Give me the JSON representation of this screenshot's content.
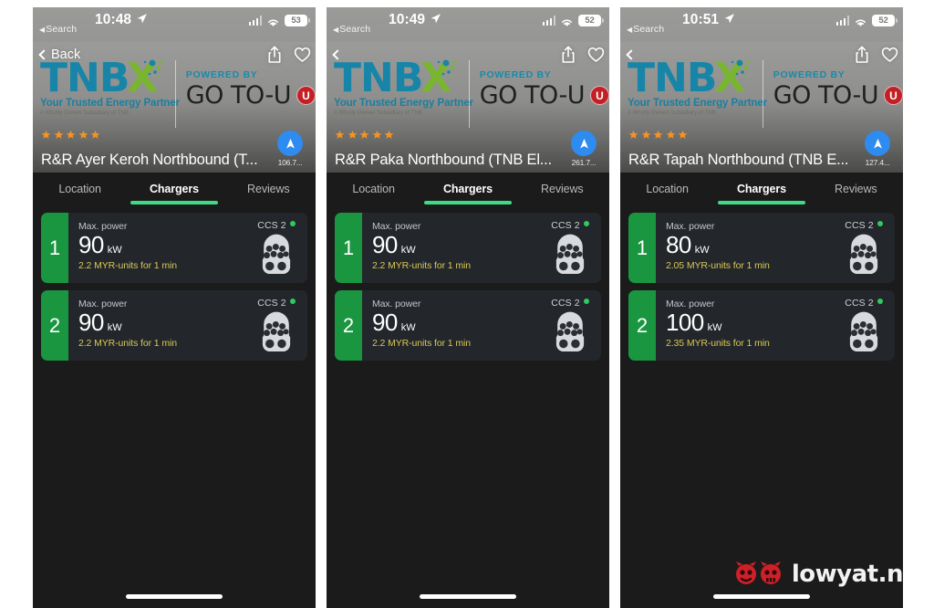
{
  "brand": {
    "logo_main": "TNB",
    "logo_accent": "X",
    "tagline": "Your Trusted Energy Partner",
    "subline": "A Wholly Owned Subsidiary of TNB",
    "powered_by": "POWERED BY",
    "partner_name": "GO TO-U",
    "partner_badge": "U",
    "colors": {
      "tnb_blue": "#1785a8",
      "x_green": "#79b530",
      "partner_red": "#c32026",
      "accent_green": "#3ddc84",
      "card_green": "#1a9641",
      "price_yellow": "#d9c756",
      "nav_blue": "#2e8bef",
      "star_orange": "#f59323"
    }
  },
  "icons": {
    "back": "chevron-left-icon",
    "share": "share-icon",
    "favorite": "heart-icon",
    "navigate": "navigate-arrow-icon",
    "connector": "ccs2-connector-icon",
    "signal": "cellular-signal-icon",
    "wifi": "wifi-icon",
    "battery": "battery-icon",
    "location": "location-arrow-icon",
    "star": "star-icon"
  },
  "tabs": [
    {
      "label": "Location",
      "active": false
    },
    {
      "label": "Chargers",
      "active": true
    },
    {
      "label": "Reviews",
      "active": false
    }
  ],
  "labels": {
    "max_power": "Max. power",
    "kw": "kW",
    "connector": "CCS 2",
    "back": "Back",
    "search_back": "Search"
  },
  "screens": [
    {
      "status": {
        "time": "10:48",
        "back_app": "Search",
        "battery": "53"
      },
      "back_label": "Back",
      "title": "R&R Ayer Keroh Northbound (T...",
      "distance": "106.7...",
      "rating": 5,
      "chargers": [
        {
          "index": "1",
          "max_power_label": "Max. power",
          "power": "90",
          "unit": "kW",
          "price": "2.2 MYR-units for 1 min",
          "connector": "CCS 2",
          "available": true
        },
        {
          "index": "2",
          "max_power_label": "Max. power",
          "power": "90",
          "unit": "kW",
          "price": "2.2 MYR-units for 1 min",
          "connector": "CCS 2",
          "available": true
        }
      ]
    },
    {
      "status": {
        "time": "10:49",
        "back_app": "Search",
        "battery": "52"
      },
      "back_label": "",
      "title": "R&R Paka Northbound (TNB El...",
      "distance": "261.7...",
      "rating": 5,
      "chargers": [
        {
          "index": "1",
          "max_power_label": "Max. power",
          "power": "90",
          "unit": "kW",
          "price": "2.2 MYR-units for 1 min",
          "connector": "CCS 2",
          "available": true
        },
        {
          "index": "2",
          "max_power_label": "Max. power",
          "power": "90",
          "unit": "kW",
          "price": "2.2 MYR-units for 1 min",
          "connector": "CCS 2",
          "available": true
        }
      ]
    },
    {
      "status": {
        "time": "10:51",
        "back_app": "Search",
        "battery": "52"
      },
      "back_label": "",
      "title": "R&R Tapah Northbound (TNB E...",
      "distance": "127.4...",
      "rating": 5,
      "chargers": [
        {
          "index": "1",
          "max_power_label": "Max. power",
          "power": "80",
          "unit": "kW",
          "price": "2.05 MYR-units for 1 min",
          "connector": "CCS 2",
          "available": true
        },
        {
          "index": "2",
          "max_power_label": "Max. power",
          "power": "100",
          "unit": "kW",
          "price": "2.35 MYR-units for 1 min",
          "connector": "CCS 2",
          "available": true
        }
      ]
    }
  ],
  "watermark": {
    "text": "lowyat.n"
  }
}
